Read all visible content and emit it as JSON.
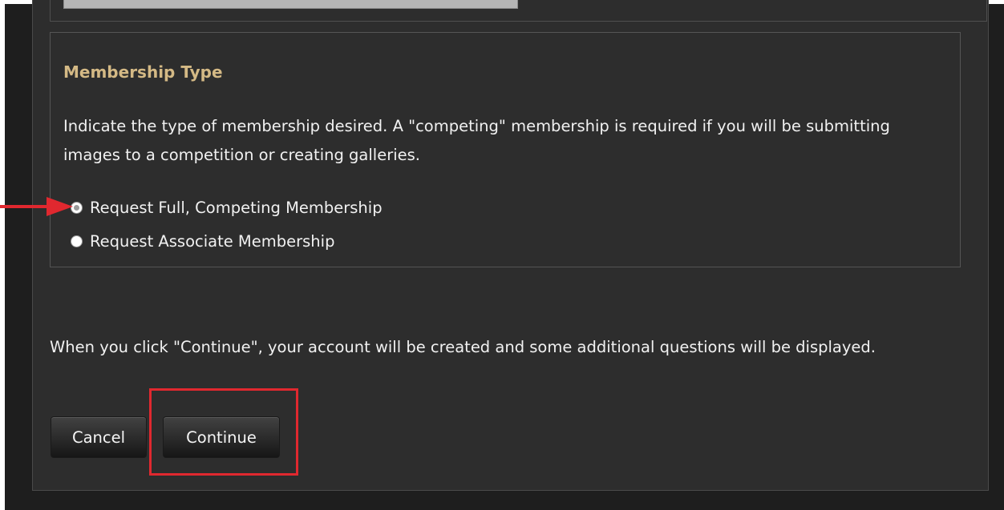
{
  "membership": {
    "title": "Membership Type",
    "description": "Indicate the type of membership desired. A \"competing\" membership is required if you will be submitting images to a competition or creating galleries.",
    "options": [
      {
        "label": "Request Full, Competing Membership",
        "selected": true
      },
      {
        "label": "Request Associate Membership",
        "selected": false
      }
    ]
  },
  "info_text": "When you click \"Continue\", your account will be created and some additional questions will be displayed.",
  "buttons": {
    "cancel": "Cancel",
    "continue": "Continue"
  },
  "annotations": {
    "arrow_color": "#e0282f",
    "highlight_color": "#e0282f"
  },
  "colors": {
    "background": "#2d2d2d",
    "title": "#d4b985",
    "text": "#f1f1f1"
  }
}
